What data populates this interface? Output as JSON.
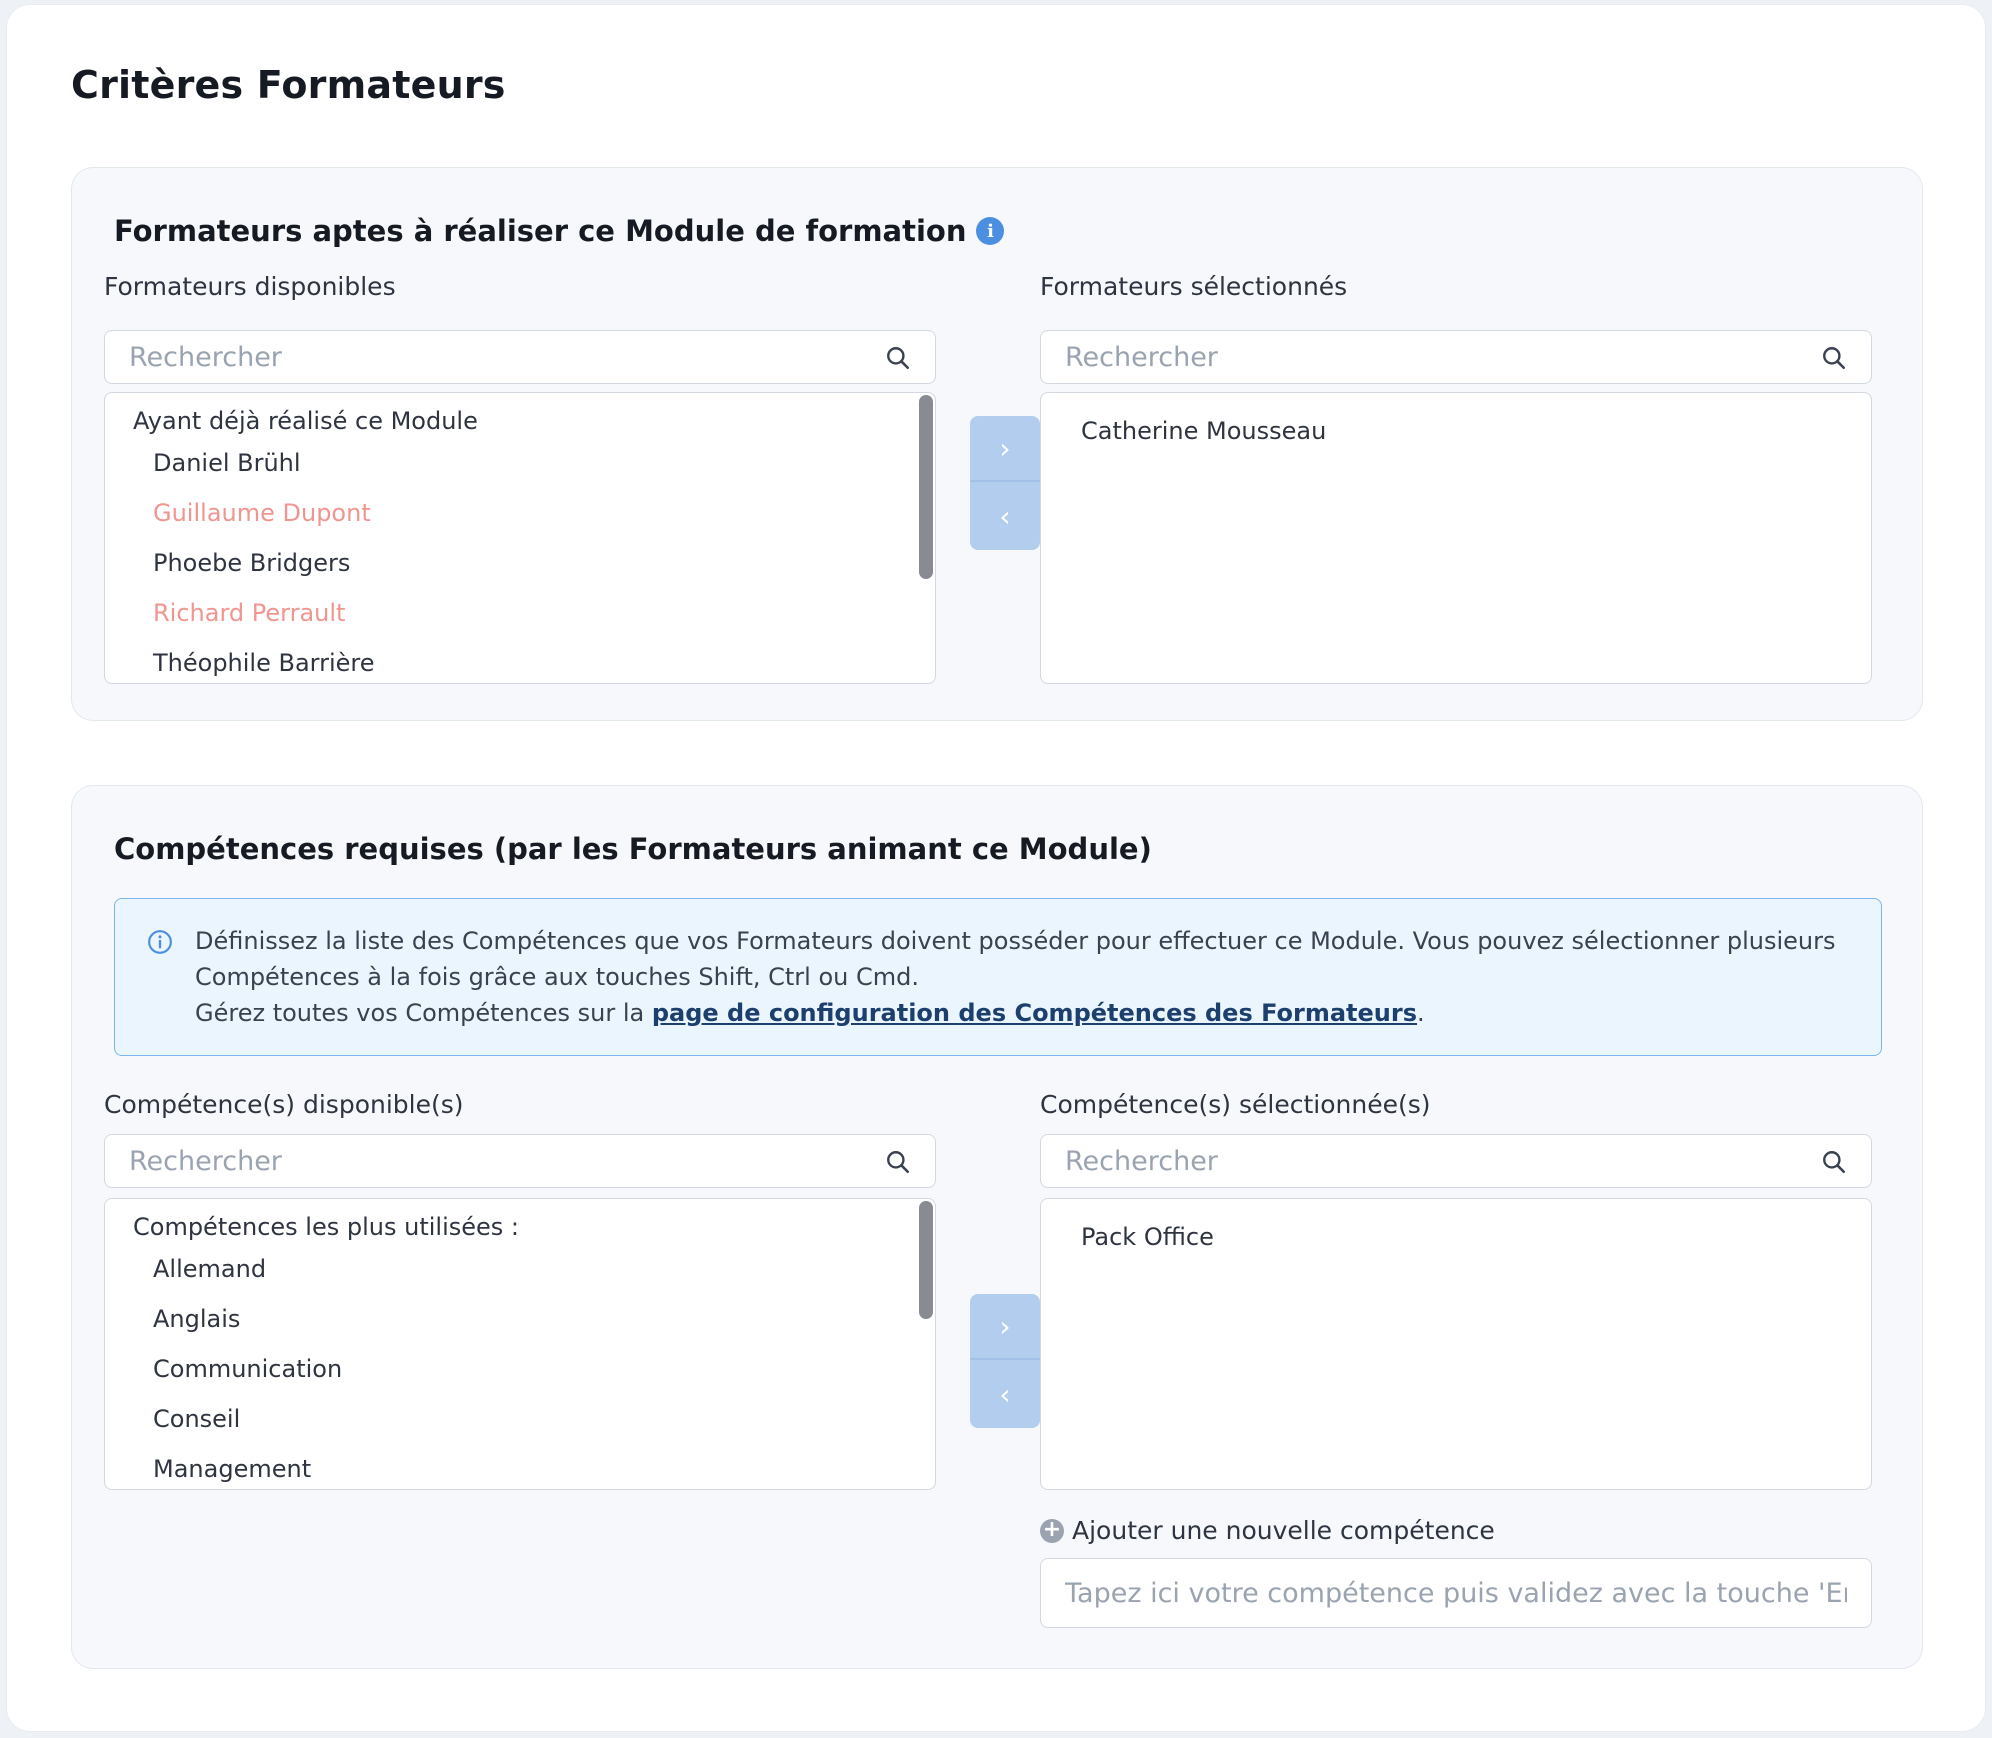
{
  "page": {
    "title": "Critères Formateurs"
  },
  "trainers": {
    "title": "Formateurs aptes à réaliser ce Module de formation",
    "info_icon": "i",
    "available_label": "Formateurs disponibles",
    "selected_label": "Formateurs sélectionnés",
    "search_placeholder": "Rechercher",
    "group_label": "Ayant déjà réalisé ce Module",
    "available_items": [
      {
        "name": "Daniel Brühl",
        "highlight": false
      },
      {
        "name": "Guillaume Dupont",
        "highlight": true
      },
      {
        "name": "Phoebe Bridgers",
        "highlight": false
      },
      {
        "name": "Richard Perrault",
        "highlight": true
      },
      {
        "name": "Théophile Barrière",
        "highlight": false
      }
    ],
    "selected_items": [
      "Catherine Mousseau"
    ],
    "move_right": "›",
    "move_left": "‹"
  },
  "skills": {
    "title": "Compétences requises (par les Formateurs animant ce Module)",
    "banner": {
      "text_1": "Définissez la liste des Compétences que vos Formateurs doivent posséder pour effectuer ce Module. Vous pouvez sélectionner plusieurs Compétences à la fois grâce aux touches Shift, Ctrl ou Cmd.",
      "text_2_prefix": "Gérez toutes vos Compétences sur la ",
      "link": "page de configuration des Compétences des Formateurs",
      "text_2_suffix": "."
    },
    "available_label": "Compétence(s) disponible(s)",
    "selected_label": "Compétence(s) sélectionnée(s)",
    "search_placeholder": "Rechercher",
    "group_label": "Compétences les plus utilisées :",
    "available_items": [
      "Allemand",
      "Anglais",
      "Communication",
      "Conseil",
      "Management"
    ],
    "selected_items": [
      "Pack Office"
    ],
    "move_right": "›",
    "move_left": "‹",
    "add_label": "Ajouter une nouvelle compétence",
    "add_icon": "+",
    "add_placeholder": "Tapez ici votre compétence puis validez avec la touche 'Entrée'"
  },
  "colors": {
    "accent": "#4c8fe0",
    "highlight_item": "#f0958f",
    "arrow_bg": "#b3cdee",
    "banner_bg": "#eaf5fe"
  }
}
